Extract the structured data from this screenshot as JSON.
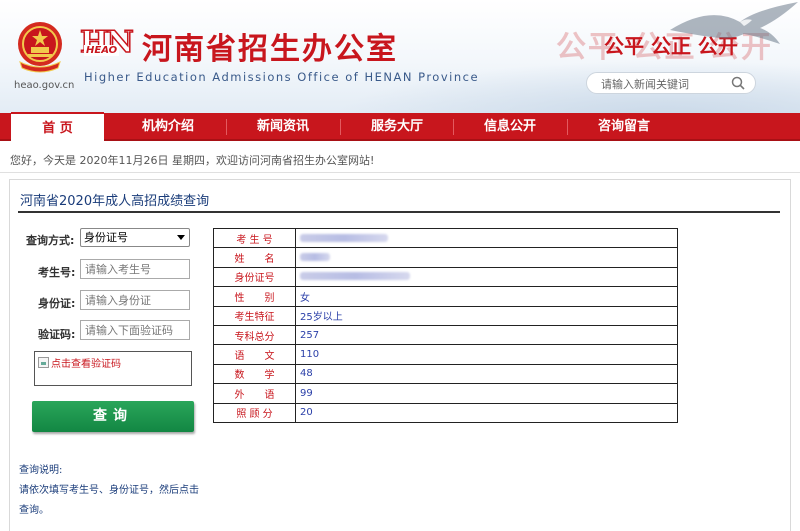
{
  "header": {
    "domain": "heao.gov.cn",
    "logo_mark": "HN",
    "logo_sub": "HEAO",
    "title": "河南省招生办公室",
    "subtitle": "Higher Education Admissions Office of HENAN Province",
    "slogan": "公平 公正 公开",
    "slogan_ghost": "公平 公正 公开",
    "search_placeholder": "请输入新闻关键词"
  },
  "nav": {
    "items": [
      {
        "label": "首 页",
        "active": true
      },
      {
        "label": "机构介绍",
        "active": false
      },
      {
        "label": "新闻资讯",
        "active": false
      },
      {
        "label": "服务大厅",
        "active": false
      },
      {
        "label": "信息公开",
        "active": false
      },
      {
        "label": "咨询留言",
        "active": false
      }
    ]
  },
  "welcome": "您好，今天是 2020年11月26日 星期四，欢迎访问河南省招生办公室网站!",
  "panel": {
    "title": "河南省2020年成人高招成绩查询"
  },
  "form": {
    "query_method_label": "查询方式:",
    "query_method_value": "身份证号",
    "exam_no_label": "考生号:",
    "exam_no_placeholder": "请输入考生号",
    "id_label": "身份证:",
    "id_placeholder": "请输入身份证",
    "captcha_label": "验证码:",
    "captcha_placeholder": "请输入下面验证码",
    "captcha_img_alt": "点击查看验证码",
    "submit_label": "查询"
  },
  "notes": {
    "title": "查询说明:",
    "body": "请依次填写考生号、身份证号，然后点击查询。"
  },
  "results": [
    {
      "label": "考 生 号",
      "value": "",
      "redacted": true,
      "redact_w": 88
    },
    {
      "label": "姓　　名",
      "value": "",
      "redacted": true,
      "redact_w": 30
    },
    {
      "label": "身份证号",
      "value": "",
      "redacted": true,
      "redact_w": 110
    },
    {
      "label": "性　　别",
      "value": "女"
    },
    {
      "label": "考生特征",
      "value": "25岁以上"
    },
    {
      "label": "专科总分",
      "value": "257"
    },
    {
      "label": "语　　文",
      "value": "110"
    },
    {
      "label": "数　　学",
      "value": "48"
    },
    {
      "label": "外　　语",
      "value": "99"
    },
    {
      "label": "照 顾 分",
      "value": "20"
    }
  ],
  "colors": {
    "brand_red": "#c8161d",
    "button_green": "#1a9a4f",
    "link_blue": "#2a3fa8"
  }
}
